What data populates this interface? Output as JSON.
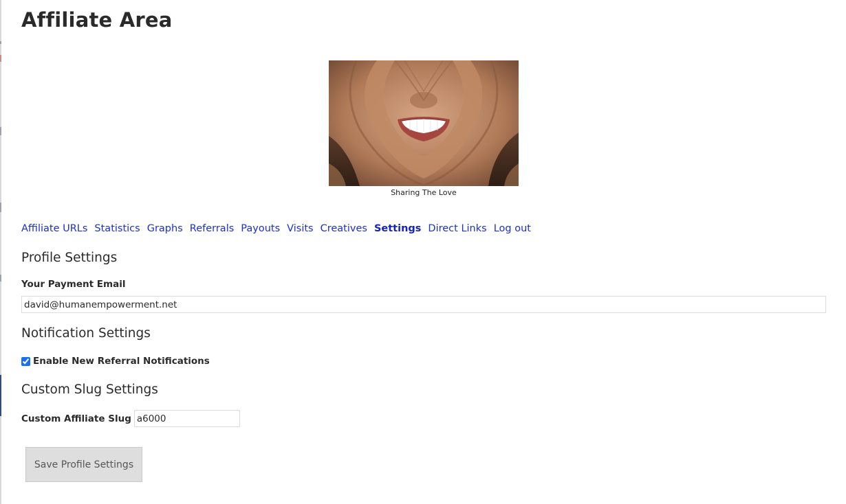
{
  "page": {
    "title": "Affiliate Area"
  },
  "hero": {
    "caption": "Sharing The Love"
  },
  "tabs": [
    {
      "label": "Affiliate URLs",
      "active": false
    },
    {
      "label": "Statistics",
      "active": false
    },
    {
      "label": "Graphs",
      "active": false
    },
    {
      "label": "Referrals",
      "active": false
    },
    {
      "label": "Payouts",
      "active": false
    },
    {
      "label": "Visits",
      "active": false
    },
    {
      "label": "Creatives",
      "active": false
    },
    {
      "label": "Settings",
      "active": true
    },
    {
      "label": "Direct Links",
      "active": false
    },
    {
      "label": "Log out",
      "active": false
    }
  ],
  "profile": {
    "heading": "Profile Settings",
    "email_label": "Your Payment Email",
    "email_value": "david@humanempowerment.net"
  },
  "notifications": {
    "heading": "Notification Settings",
    "referral_label": "Enable New Referral Notifications",
    "referral_checked": true
  },
  "slug": {
    "heading": "Custom Slug Settings",
    "label": "Custom Affiliate Slug",
    "value": "a6000"
  },
  "actions": {
    "save_label": "Save Profile Settings"
  },
  "colors": {
    "link": "#1a2fd6",
    "button_bg": "#dedede",
    "checkbox": "#1a6ef0"
  }
}
